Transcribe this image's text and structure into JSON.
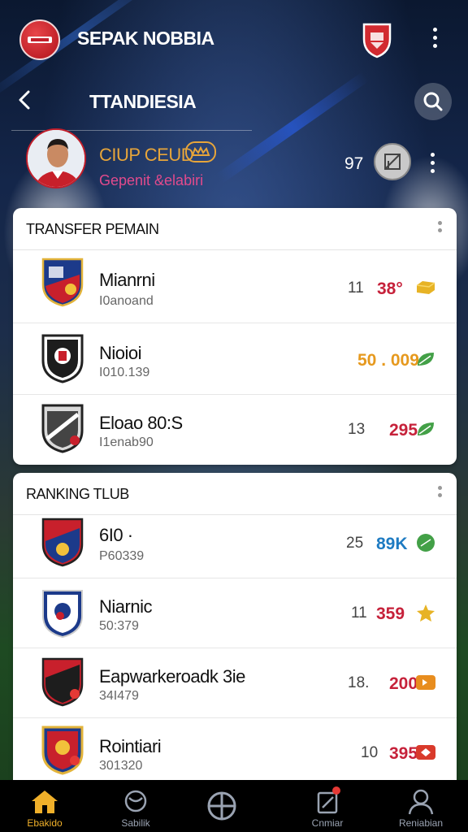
{
  "header": {
    "app_title": "SEPAK NOBBIA",
    "section_title": "TTANDIESIA"
  },
  "profile": {
    "club_name": "CIUP CEUD",
    "club_subtitle": "Gepenit &elabiri",
    "score": "97"
  },
  "transfer": {
    "title": "TRANSFER PEMAIN",
    "rows": [
      {
        "name": "Mianrni",
        "sub": "I0anoand",
        "rank": "11",
        "value": "38°",
        "value_color": "#c6213a",
        "icon": "gold-coin-icon",
        "icon_color": "#e7b325"
      },
      {
        "name": "Nioioi",
        "sub": "I010.139",
        "rank": "",
        "value": "50 . 009",
        "value_color": "#e6991e",
        "icon": "green-leaf-icon",
        "icon_color": "#43a047"
      },
      {
        "name": "Eloao 80:S",
        "sub": "I1enab90",
        "rank": "13",
        "value": "295",
        "value_color": "#c6213a",
        "icon": "green-leaf-icon",
        "icon_color": "#43a047"
      }
    ]
  },
  "ranking": {
    "title": "RANKING TLUB",
    "rows": [
      {
        "name": "6I0 ·",
        "sub": "P60339",
        "rank": "25",
        "value": "89K",
        "value_color": "#1e7bc2",
        "icon": "green-ball-icon",
        "icon_color": "#43a047"
      },
      {
        "name": "Niarnic",
        "sub": "50:379",
        "rank": "11",
        "value": "359",
        "value_color": "#c6213a",
        "icon": "star-icon",
        "icon_color": "#e7b325"
      },
      {
        "name": "Eapwarkeroadk 3ie",
        "sub": "34I479",
        "rank": "18.",
        "value": "200",
        "value_color": "#c6213a",
        "icon": "orange-tag-icon",
        "icon_color": "#e88d1e"
      },
      {
        "name": "Rointiari",
        "sub": "301320",
        "rank": "10",
        "value": "395",
        "value_color": "#c6213a",
        "icon": "red-tag-icon",
        "icon_color": "#d93a2b"
      }
    ]
  },
  "nav": {
    "items": [
      {
        "label": "Ebakido",
        "icon": "home-icon"
      },
      {
        "label": "Sabilik",
        "icon": "ball-icon"
      },
      {
        "label": "",
        "icon": "target-icon"
      },
      {
        "label": "Cnmiar",
        "icon": "edit-icon"
      },
      {
        "label": "Reniabian",
        "icon": "profile-icon"
      }
    ]
  },
  "colors": {
    "accent": "#f0b02a",
    "brand_red": "#c11e2b",
    "navy": "#0d1b33"
  }
}
